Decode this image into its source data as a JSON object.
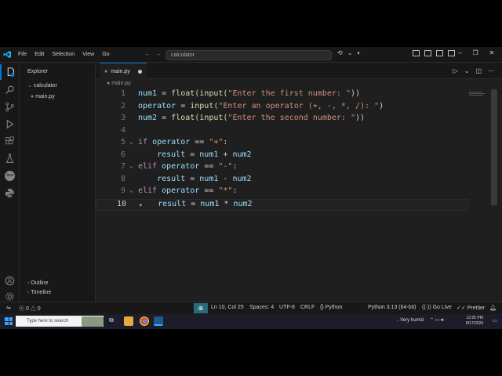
{
  "window": {
    "menu": [
      "File",
      "Edit",
      "Selection",
      "View",
      "Go"
    ],
    "command_center": "calculator",
    "accent": "#0078d4"
  },
  "activity_bar": {
    "items": [
      "explorer-icon",
      "search-icon",
      "source-control-icon",
      "run-debug-icon",
      "extensions-icon",
      "testing-icon",
      "json-icon",
      "python-icon"
    ],
    "bottom": [
      "account-icon",
      "settings-icon"
    ],
    "explorer_badge": "1",
    "json_label": "Json"
  },
  "sidebar": {
    "title": "Explorer",
    "folder": "calculator",
    "file": "main.py",
    "outline": "Outline",
    "timeline": "Timeline"
  },
  "editor": {
    "tab_label": "main.py",
    "breadcrumb": "main.py",
    "current_line": 10,
    "lines": [
      {
        "n": "1",
        "tokens": [
          [
            "id",
            "num1"
          ],
          [
            "p",
            " = "
          ],
          [
            "fn",
            "float"
          ],
          [
            "p",
            "("
          ],
          [
            "fn",
            "input"
          ],
          [
            "p",
            "("
          ],
          [
            "str",
            "\"Enter the first number: \""
          ],
          [
            "p",
            "))"
          ]
        ]
      },
      {
        "n": "2",
        "tokens": [
          [
            "id",
            "operator"
          ],
          [
            "p",
            " = "
          ],
          [
            "fn",
            "input"
          ],
          [
            "p",
            "("
          ],
          [
            "str",
            "\"Enter an operator (+, -, *, /): \""
          ],
          [
            "p",
            ")"
          ]
        ]
      },
      {
        "n": "3",
        "tokens": [
          [
            "id",
            "num2"
          ],
          [
            "p",
            " = "
          ],
          [
            "fn",
            "float"
          ],
          [
            "p",
            "("
          ],
          [
            "fn",
            "input"
          ],
          [
            "p",
            "("
          ],
          [
            "str",
            "\"Enter the second number: \""
          ],
          [
            "p",
            "))"
          ]
        ]
      },
      {
        "n": "4",
        "tokens": []
      },
      {
        "n": "5",
        "tokens": [
          [
            "kw",
            "if"
          ],
          [
            "p",
            " "
          ],
          [
            "id",
            "operator"
          ],
          [
            "p",
            " == "
          ],
          [
            "str",
            "\"+\""
          ],
          [
            "p",
            ":"
          ]
        ]
      },
      {
        "n": "6",
        "tokens": [
          [
            "p",
            "    "
          ],
          [
            "id",
            "result"
          ],
          [
            "p",
            " = "
          ],
          [
            "id",
            "num1"
          ],
          [
            "p",
            " + "
          ],
          [
            "id",
            "num2"
          ]
        ]
      },
      {
        "n": "7",
        "tokens": [
          [
            "kw",
            "elif"
          ],
          [
            "p",
            " "
          ],
          [
            "id",
            "operator"
          ],
          [
            "p",
            " == "
          ],
          [
            "str",
            "\"-\""
          ],
          [
            "p",
            ":"
          ]
        ]
      },
      {
        "n": "8",
        "tokens": [
          [
            "p",
            "    "
          ],
          [
            "id",
            "result"
          ],
          [
            "p",
            " = "
          ],
          [
            "id",
            "num1"
          ],
          [
            "p",
            " - "
          ],
          [
            "id",
            "num2"
          ]
        ]
      },
      {
        "n": "9",
        "tokens": [
          [
            "kw",
            "elif"
          ],
          [
            "p",
            " "
          ],
          [
            "id",
            "operator"
          ],
          [
            "p",
            " == "
          ],
          [
            "str",
            "\"*\""
          ],
          [
            "p",
            ":"
          ]
        ]
      },
      {
        "n": "10",
        "tokens": [
          [
            "p",
            "    "
          ],
          [
            "id",
            "result"
          ],
          [
            "p",
            " = "
          ],
          [
            "id",
            "num1"
          ],
          [
            "p",
            " * "
          ],
          [
            "id",
            "num2"
          ]
        ]
      }
    ]
  },
  "statusbar": {
    "errors": "0",
    "warnings": "0",
    "position": "Ln 10, Col 25",
    "spaces": "Spaces: 4",
    "encoding": "UTF-8",
    "eol": "CRLF",
    "language": "Python",
    "interpreter": "Python 3.13 (64-bit)",
    "golive": "Go Live",
    "prettier": "Prettier"
  },
  "taskbar": {
    "search_placeholder": "Type here to search",
    "weather": "Very humid",
    "time": "12:25 PM",
    "date": "8/17/2026"
  }
}
